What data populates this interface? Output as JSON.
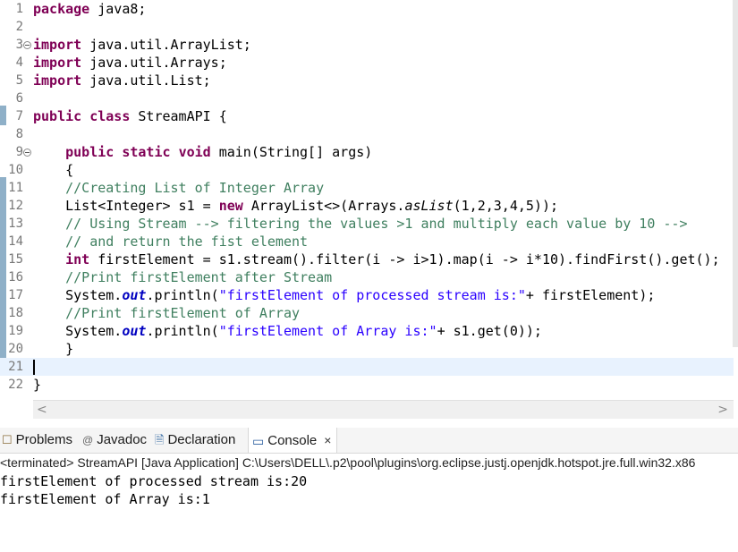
{
  "editor": {
    "lines": [
      {
        "num": "1",
        "html": "<span class=\"kw\">package</span> java8;"
      },
      {
        "num": "2",
        "html": ""
      },
      {
        "num": "3",
        "fold": true,
        "html": "<span class=\"kw\">import</span> java.util.ArrayList;"
      },
      {
        "num": "4",
        "html": "<span class=\"kw\">import</span> java.util.Arrays;"
      },
      {
        "num": "5",
        "html": "<span class=\"kw\">import</span> java.util.List;"
      },
      {
        "num": "6",
        "html": ""
      },
      {
        "num": "7",
        "html": "<span class=\"kw\">public</span> <span class=\"kw\">class</span> StreamAPI {"
      },
      {
        "num": "8",
        "html": ""
      },
      {
        "num": "9",
        "fold": true,
        "html": "    <span class=\"kw\">public</span> <span class=\"kw\">static</span> <span class=\"kw\">void</span> main(String[] args)"
      },
      {
        "num": "10",
        "html": "    {"
      },
      {
        "num": "11",
        "html": "    <span class=\"cm\">//Creating List of Integer Array</span>"
      },
      {
        "num": "12",
        "html": "    List&lt;Integer&gt; s1 = <span class=\"kw\">new</span> ArrayList&lt;&gt;(Arrays.<span class=\"ital\">asList</span>(1,2,3,4,5));"
      },
      {
        "num": "13",
        "html": "    <span class=\"cm\">// Using Stream --&gt; filtering the values &gt;1 and multiply each value by 10 --&gt;</span>"
      },
      {
        "num": "14",
        "html": "    <span class=\"cm\">// and return the fist element</span>"
      },
      {
        "num": "15",
        "html": "    <span class=\"kw\">int</span> firstElement = s1.stream().filter(i -&gt; i&gt;1).map(i -&gt; i*10).findFirst().get();"
      },
      {
        "num": "16",
        "html": "    <span class=\"cm\">//Print firstElement after Stream</span>"
      },
      {
        "num": "17",
        "html": "    System.<span class=\"fld\">out</span>.println(<span class=\"str\">\"firstElement of processed stream is:\"</span>+ firstElement);"
      },
      {
        "num": "18",
        "html": "    <span class=\"cm\">//Print firstElement of Array</span>"
      },
      {
        "num": "19",
        "html": "    System.<span class=\"fld\">out</span>.println(<span class=\"str\">\"firstElement of Array is:\"</span>+ s1.get(0));"
      },
      {
        "num": "20",
        "html": "    }"
      },
      {
        "num": "21",
        "current": true,
        "html": "<span class=\"caret\"></span>"
      },
      {
        "num": "22",
        "html": "}"
      }
    ]
  },
  "scroll": {
    "left_arrow": "<",
    "right_arrow": ">"
  },
  "tabs": [
    {
      "label": "Problems",
      "icon": "problems-icon",
      "glyph": "☐"
    },
    {
      "label": "Javadoc",
      "icon": "at-icon",
      "glyph": "@"
    },
    {
      "label": "Declaration",
      "icon": "declaration-icon",
      "glyph": "🗎"
    },
    {
      "label": "Console",
      "icon": "console-icon",
      "glyph": "▭",
      "active": true,
      "close": "×"
    }
  ],
  "console": {
    "header": "<terminated> StreamAPI [Java Application] C:\\Users\\DELL\\.p2\\pool\\plugins\\org.eclipse.justj.openjdk.hotspot.jre.full.win32.x86",
    "output": [
      "firstElement of processed stream is:20",
      "firstElement of Array is:1"
    ]
  },
  "colors": {
    "keyword": "#7f0055",
    "string": "#2a00ff",
    "comment": "#3f7f5f",
    "field": "#0000c0"
  }
}
